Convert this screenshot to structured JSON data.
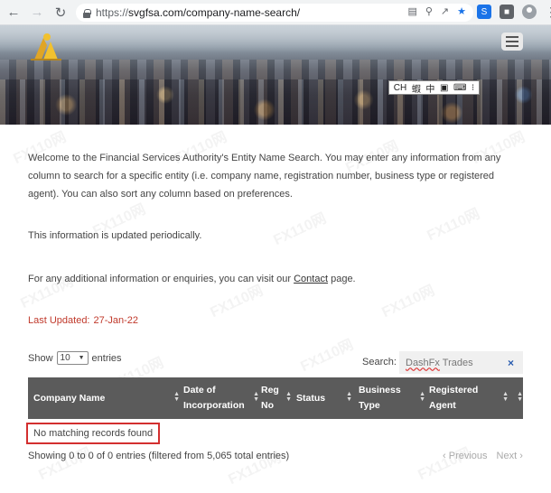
{
  "browser": {
    "url_scheme": "https://",
    "url_rest": "svgfsa.com/company-name-search/"
  },
  "hero": {
    "ime": [
      "CH",
      "蝦",
      "中",
      "▣",
      "⌨",
      "⁝"
    ]
  },
  "content": {
    "intro": "Welcome to the Financial Services Authority's Entity Name Search. You may enter any information from any column to search for a specific entity (i.e. company name, registration number, business type or registered agent). You can also sort any column based on preferences.",
    "updated_note": "This information is updated periodically.",
    "contact_prefix": "For any additional information or enquiries, you can visit our ",
    "contact_link": "Contact",
    "contact_suffix": " page.",
    "last_updated_label": "Last Updated:",
    "last_updated_date": "27-Jan-22"
  },
  "table_controls": {
    "show_label": "Show",
    "page_length": "10",
    "entries_label": "entries",
    "search_label": "Search:",
    "search_value_a": "DashFx",
    "search_value_b": " Trades",
    "clear": "×"
  },
  "table": {
    "columns": [
      {
        "line1": "Company Name",
        "line2": ""
      },
      {
        "line1": "Date of",
        "line2": "Incorporation"
      },
      {
        "line1": "Reg",
        "line2": "No"
      },
      {
        "line1": "Status",
        "line2": ""
      },
      {
        "line1": "Business",
        "line2": "Type"
      },
      {
        "line1": "Registered",
        "line2": "Agent"
      }
    ],
    "empty_message": "No matching records found",
    "info": "Showing 0 to 0 of 0 entries (filtered from 5,065 total entries)",
    "prev": "Previous",
    "next": "Next"
  },
  "colors": {
    "header_bg": "#5b5b5b",
    "last_updated": "#c0392b",
    "highlight_border": "#d32f2f"
  }
}
